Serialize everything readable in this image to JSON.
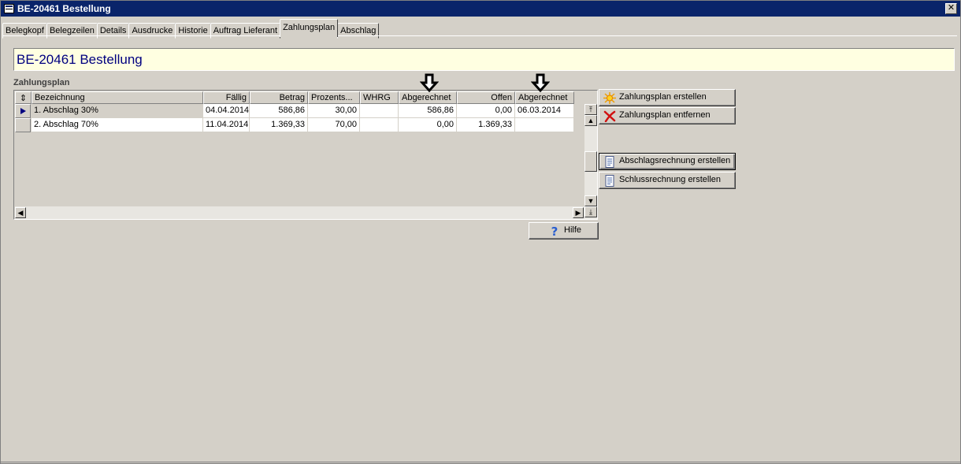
{
  "window": {
    "title": "BE-20461 Bestellung",
    "close_glyph": "✕"
  },
  "tabs": [
    {
      "label": "Belegkopf"
    },
    {
      "label": "Belegzeilen"
    },
    {
      "label": "Details"
    },
    {
      "label": "Ausdrucke"
    },
    {
      "label": "Historie"
    },
    {
      "label": "Auftrag Lieferant"
    },
    {
      "label": "Zahlungsplan",
      "active": true
    },
    {
      "label": "Abschlag"
    }
  ],
  "header": {
    "title": "BE-20461  Bestellung"
  },
  "section": {
    "label": "Zahlungsplan"
  },
  "grid": {
    "sort_glyph": "⇕",
    "columns": [
      "Bezeichnung",
      "Fällig",
      "Betrag",
      "Prozents...",
      "WHRG",
      "Abgerechnet",
      "Offen",
      "Abgerechnet"
    ],
    "rows": [
      [
        "1. Abschlag 30%",
        "04.04.2014",
        "586,86",
        "30,00",
        "",
        "586,86",
        "0,00",
        "06.03.2014"
      ],
      [
        "2. Abschlag 70%",
        "11.04.2014",
        "1.369,33",
        "70,00",
        "",
        "0,00",
        "1.369,33",
        ""
      ]
    ],
    "selected_row": 0
  },
  "buttons": {
    "create_plan": "Zahlungsplan erstellen",
    "remove_plan": "Zahlungsplan entfernen",
    "create_partial_invoice": "Abschlagsrechnung erstellen",
    "create_final_invoice": "Schlussrechnung erstellen",
    "help": "Hilfe"
  },
  "icons": {
    "create_plan": "sun-icon",
    "remove_plan": "red-x-icon",
    "create_partial_invoice": "document-icon",
    "create_final_invoice": "document-icon",
    "help": "question-icon"
  },
  "colors": {
    "titlebar": "#0a246a",
    "header_bg": "#ffffe1",
    "header_text": "#000080",
    "face": "#d4d0c8"
  }
}
